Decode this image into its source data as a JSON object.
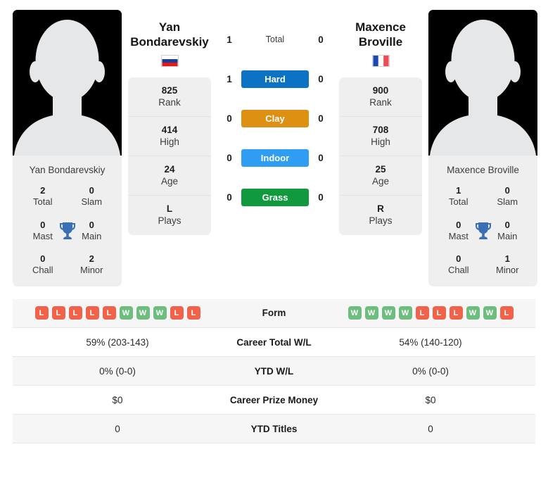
{
  "players": {
    "left": {
      "first_name": "Yan",
      "last_name": "Bondarevskiy",
      "full_name": "Yan Bondarevskiy",
      "country": "Russia",
      "flag_icon": "flag-russia-icon",
      "stats": [
        {
          "value": "825",
          "label": "Rank"
        },
        {
          "value": "414",
          "label": "High"
        },
        {
          "value": "24",
          "label": "Age"
        },
        {
          "value": "L",
          "label": "Plays"
        }
      ],
      "titles": [
        {
          "value": "2",
          "label": "Total"
        },
        {
          "value": "0",
          "label": "Slam"
        },
        {
          "value": "0",
          "label": "Mast"
        },
        {
          "value": "0",
          "label": "Main"
        },
        {
          "value": "0",
          "label": "Chall"
        },
        {
          "value": "2",
          "label": "Minor"
        }
      ],
      "form": [
        "L",
        "L",
        "L",
        "L",
        "L",
        "W",
        "W",
        "W",
        "L",
        "L"
      ],
      "career_total_wl": "59% (203-143)",
      "ytd_wl": "0% (0-0)",
      "career_prize_money": "$0",
      "ytd_titles": "0"
    },
    "right": {
      "first_name": "Maxence",
      "last_name": "Broville",
      "full_name": "Maxence Broville",
      "country": "France",
      "flag_icon": "flag-france-icon",
      "stats": [
        {
          "value": "900",
          "label": "Rank"
        },
        {
          "value": "708",
          "label": "High"
        },
        {
          "value": "25",
          "label": "Age"
        },
        {
          "value": "R",
          "label": "Plays"
        }
      ],
      "titles": [
        {
          "value": "1",
          "label": "Total"
        },
        {
          "value": "0",
          "label": "Slam"
        },
        {
          "value": "0",
          "label": "Mast"
        },
        {
          "value": "0",
          "label": "Main"
        },
        {
          "value": "0",
          "label": "Chall"
        },
        {
          "value": "1",
          "label": "Minor"
        }
      ],
      "form": [
        "W",
        "W",
        "W",
        "W",
        "L",
        "L",
        "L",
        "W",
        "W",
        "L"
      ],
      "career_total_wl": "54% (140-120)",
      "ytd_wl": "0% (0-0)",
      "career_prize_money": "$0",
      "ytd_titles": "0"
    }
  },
  "head_to_head": [
    {
      "label": "Total",
      "left": "1",
      "right": "0",
      "style": "plain",
      "color": ""
    },
    {
      "label": "Hard",
      "left": "1",
      "right": "0",
      "style": "badge",
      "color": "#0b72c4"
    },
    {
      "label": "Clay",
      "left": "0",
      "right": "0",
      "style": "badge",
      "color": "#dd9012"
    },
    {
      "label": "Indoor",
      "left": "0",
      "right": "0",
      "style": "badge",
      "color": "#2e9df2"
    },
    {
      "label": "Grass",
      "left": "0",
      "right": "0",
      "style": "badge",
      "color": "#109a3d"
    }
  ],
  "comparison_rows": [
    {
      "label": "Form",
      "kind": "form"
    },
    {
      "label": "Career Total W/L",
      "kind": "text",
      "left": "59% (203-143)",
      "right": "54% (140-120)"
    },
    {
      "label": "YTD W/L",
      "kind": "text",
      "left": "0% (0-0)",
      "right": "0% (0-0)"
    },
    {
      "label": "Career Prize Money",
      "kind": "text",
      "left": "$0",
      "right": "$0"
    },
    {
      "label": "YTD Titles",
      "kind": "text",
      "left": "0",
      "right": "0"
    }
  ],
  "colors": {
    "win": "#6cbd7e",
    "loss": "#f0634a",
    "trophy": "#3a6fb5",
    "card_bg": "#efefef"
  },
  "trophy_icon": "trophy-icon"
}
